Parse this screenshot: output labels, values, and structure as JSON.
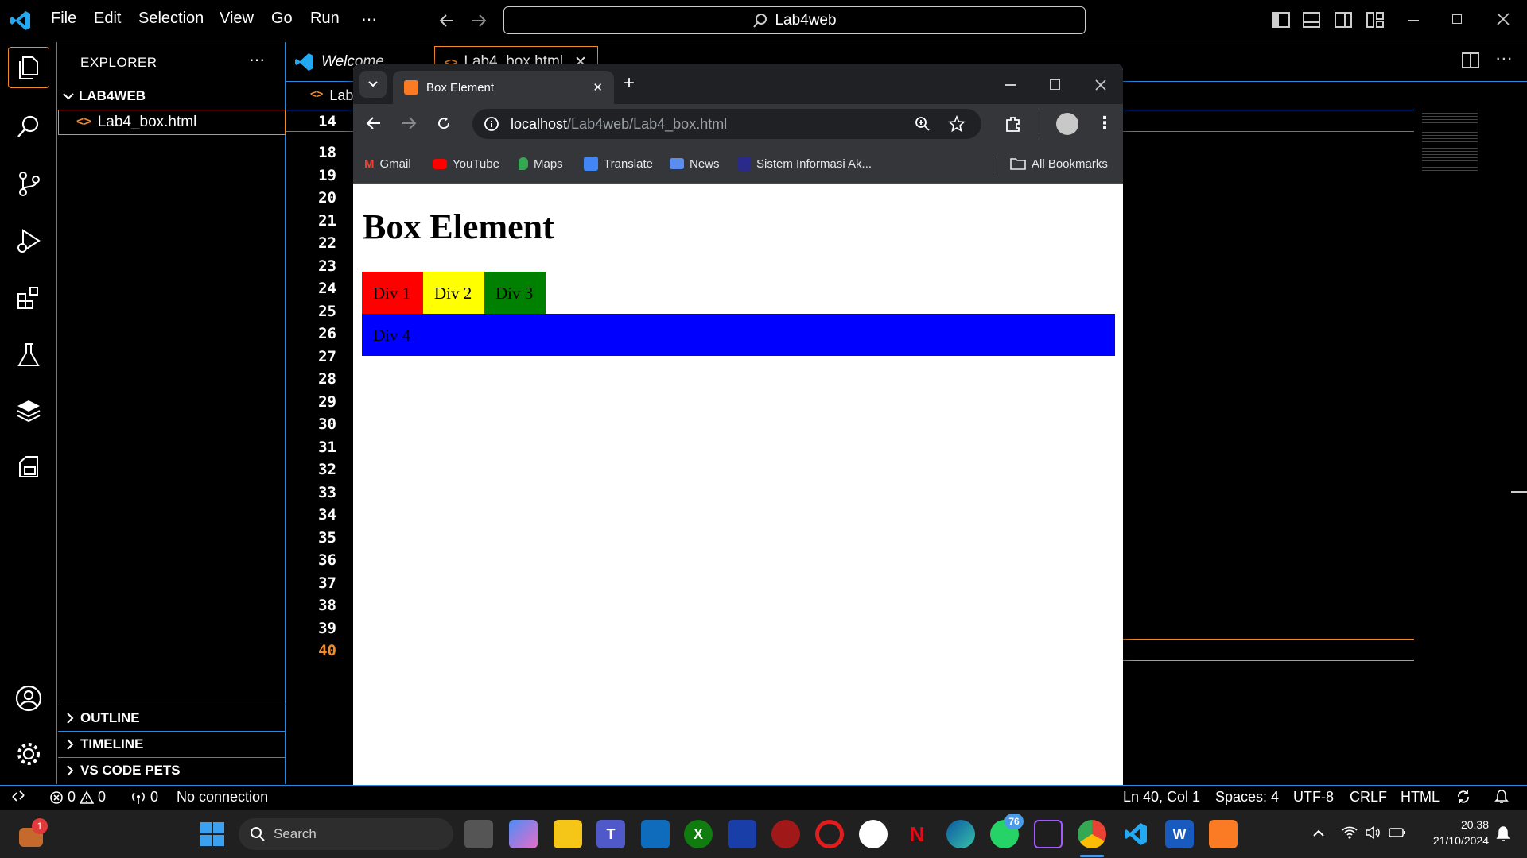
{
  "vscode": {
    "menu": [
      "File",
      "Edit",
      "Selection",
      "View",
      "Go",
      "Run",
      "⋯"
    ],
    "command_center": "Lab4web",
    "explorer_title": "EXPLORER",
    "folder": "LAB4WEB",
    "file": "Lab4_box.html",
    "sections": [
      "OUTLINE",
      "TIMELINE",
      "VS CODE PETS"
    ],
    "tabs": {
      "welcome": "Welcome",
      "active": "Lab4_box.html"
    },
    "breadcrumb": "Lab",
    "line_numbers": [
      "14",
      "18",
      "19",
      "20",
      "21",
      "22",
      "23",
      "24",
      "25",
      "26",
      "27",
      "28",
      "29",
      "30",
      "31",
      "32",
      "33",
      "34",
      "35",
      "36",
      "37",
      "38",
      "39",
      "40"
    ],
    "current_line": "40",
    "status": {
      "errors": "0",
      "warnings": "0",
      "ports": "0",
      "connection": "No connection",
      "position": "Ln 40, Col 1",
      "spaces": "Spaces: 4",
      "encoding": "UTF-8",
      "eol": "CRLF",
      "language": "HTML"
    }
  },
  "chrome": {
    "tab_title": "Box Element",
    "url_host": "localhost",
    "url_path": "/Lab4web/Lab4_box.html",
    "bookmarks": [
      "Gmail",
      "YouTube",
      "Maps",
      "Translate",
      "News",
      "Sistem Informasi Ak..."
    ],
    "all_bookmarks": "All Bookmarks"
  },
  "page": {
    "heading": "Box Element",
    "divs": [
      {
        "label": "Div 1",
        "color": "#ff0000"
      },
      {
        "label": "Div 2",
        "color": "#ffff00"
      },
      {
        "label": "Div 3",
        "color": "#008000"
      },
      {
        "label": "Div 4",
        "color": "#0000ff"
      }
    ]
  },
  "taskbar": {
    "search": "Search",
    "time": "20.38",
    "date": "21/10/2024",
    "badges": {
      "widgets": "1",
      "whatsapp": "76"
    }
  },
  "colors": {
    "accent_border": "#2a8ae0",
    "orange": "#f38b2a",
    "chrome_dark": "#202124",
    "chrome_bar": "#35363a"
  }
}
